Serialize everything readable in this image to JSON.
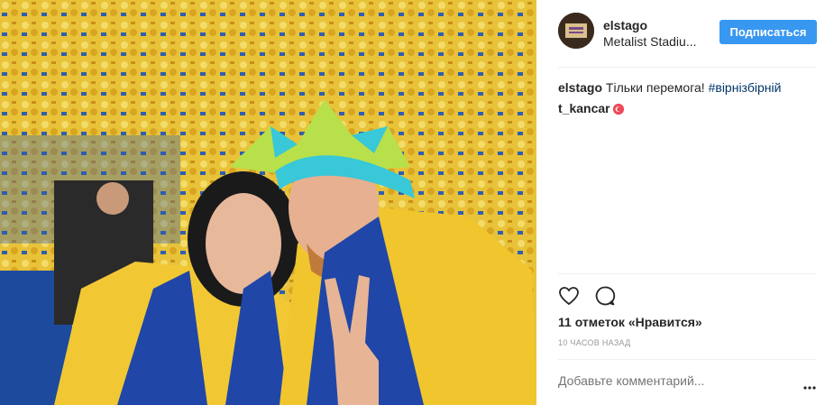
{
  "post": {
    "username": "elstago",
    "location": "Metalist Stadiu...",
    "follow_label": "Подписаться",
    "caption_user": "elstago",
    "caption_text": "Тільки перемога!",
    "caption_hashtag": "#вірнізбірній",
    "comment_user": "t_kancar",
    "likes": "11 отметок «Нравится»",
    "time_ago": "10 часов назад",
    "comment_placeholder": "Добавьте комментарий..."
  },
  "colors": {
    "accent": "#3897f0",
    "badge": "#ed4956",
    "hashtag": "#003569",
    "meta": "#999999"
  },
  "icons": {
    "like": "heart-icon",
    "comment": "speech-bubble-icon",
    "more": "ellipsis-icon",
    "verified_like_badge": "badge-icon"
  }
}
